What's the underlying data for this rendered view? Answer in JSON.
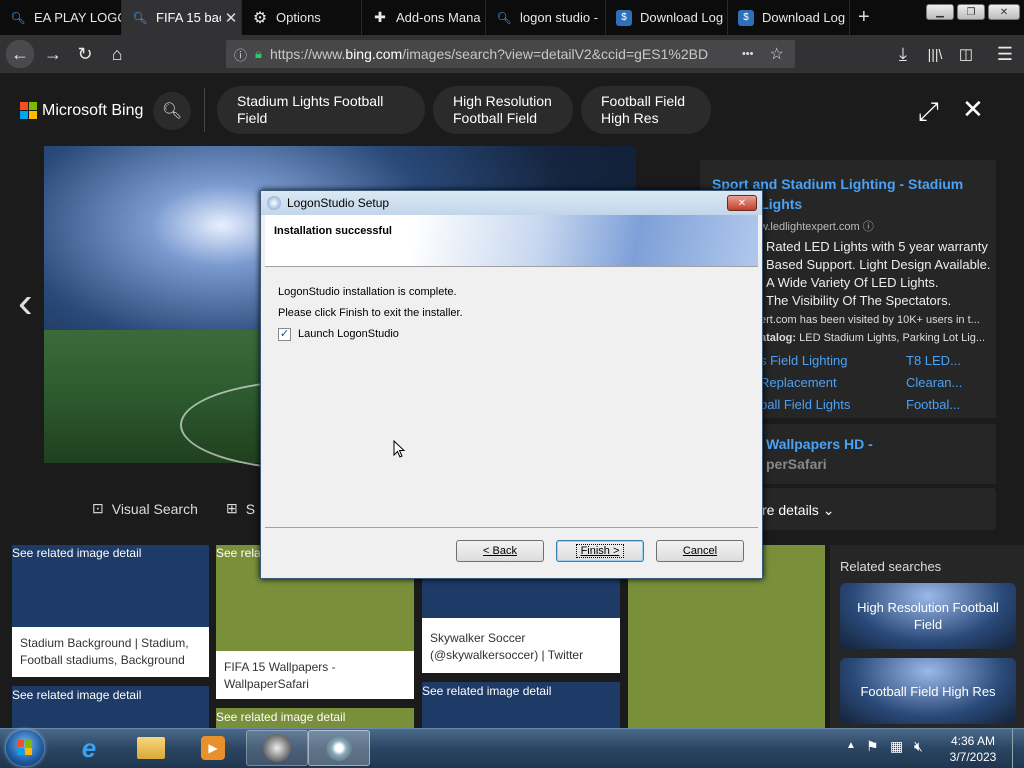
{
  "browser": {
    "tabs": [
      {
        "label": "EA PLAY LOGO",
        "icon": "search-icon"
      },
      {
        "label": "FIFA 15 bac",
        "icon": "search-icon",
        "active": true
      },
      {
        "label": "Options",
        "icon": "gear-icon"
      },
      {
        "label": "Add-ons Mana",
        "icon": "puzzle-icon"
      },
      {
        "label": "logon studio -",
        "icon": "search-icon"
      },
      {
        "label": "Download Log",
        "icon": "download-site-icon"
      },
      {
        "label": "Download Log",
        "icon": "download-site-icon"
      }
    ],
    "url_prefix": "https://www.",
    "url_domain": "bing.com",
    "url_rest": "/images/search?view=detailV2&ccid=gES1%2BD",
    "menu_dots": "•••"
  },
  "bing": {
    "logo_text": "Microsoft Bing",
    "pills": [
      "Stadium Lights Football Field",
      "High Resolution Football Field",
      "Football Field High Res"
    ],
    "visual_search": "Visual Search",
    "save_partial": "S",
    "more_details": "re details"
  },
  "ad": {
    "title": "Sport and Stadium Lighting - Stadium Sports Lights",
    "source": "w.ledlightexpert.com",
    "lines": [
      "Rated LED Lights with 5 year warranty",
      "Based Support. Light Design Available.",
      "A Wide Variety Of LED Lights.",
      "The Visibility Of The Spectators."
    ],
    "visited": "ert.com has been visited by 10K+ users in t...",
    "catalog_label": "atalog: ",
    "catalog_text": "LED Stadium Lights, Parking Lot Lig...",
    "links": [
      "s Field Lighting",
      "T8 LED...",
      "Replacement",
      "Clearan...",
      "ball Field Lights",
      "Footbal..."
    ]
  },
  "second_result": {
    "title": "Wallpapers HD -",
    "subtitle": "perSafari"
  },
  "grid": {
    "see_related": "See related image detail",
    "captions": [
      "Stadium Background | Stadium, Football stadiums, Background",
      "FIFA 15 Wallpapers - WallpaperSafari",
      "Skywalker Soccer (@skywalkersoccer) | Twitter"
    ]
  },
  "related": {
    "heading": "Related searches",
    "items": [
      "High Resolution Football Field",
      "Football Field High Res"
    ]
  },
  "dialog": {
    "title": "LogonStudio Setup",
    "heading": "Installation successful",
    "line1": "LogonStudio installation is complete.",
    "line2": "Please click Finish to exit the installer.",
    "checkbox_label": "Launch LogonStudio",
    "checkbox_checked": true,
    "back": "< Back",
    "finish": "Finish >",
    "cancel": "Cancel"
  },
  "taskbar": {
    "time": "4:36 AM",
    "date": "3/7/2023"
  },
  "colors": {
    "link_blue": "#4aa2f7",
    "tile_navy": "#1e3a66",
    "tile_olive": "#7a8f3a"
  }
}
